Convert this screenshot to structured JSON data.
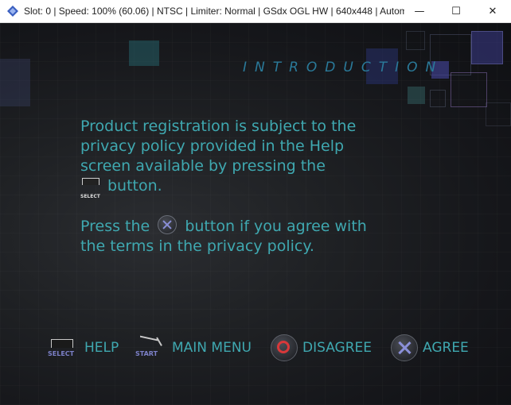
{
  "window": {
    "title": "Slot: 0 | Speed: 100% (60.06) | NTSC | Limiter: Normal | GSdx OGL HW | 640x448 | Automat...",
    "minimize_symbol": "—",
    "maximize_symbol": "☐",
    "close_symbol": "✕"
  },
  "game": {
    "heading": "INTRODUCTION",
    "paragraph1_line1": "Product registration is subject to the",
    "paragraph1_line2": "privacy policy provided in the Help",
    "paragraph1_line3": "screen available by pressing the",
    "paragraph1_line4_after": "button.",
    "paragraph2_before": "Press the",
    "paragraph2_after": "button if you agree with",
    "paragraph2_line2": "the terms in the privacy policy.",
    "inline_select_label": "SELECT",
    "footer": {
      "help": {
        "button_label": "SELECT",
        "label": "HELP"
      },
      "main_menu": {
        "button_label": "START",
        "label": "MAIN MENU"
      },
      "disagree": {
        "label": "DISAGREE"
      },
      "agree": {
        "label": "AGREE"
      }
    }
  },
  "colors": {
    "text_teal": "#3fa8b0",
    "heading_blue": "#2a7a9a",
    "circle_red": "#d8383a",
    "cross_blue": "#8a8fd8"
  }
}
